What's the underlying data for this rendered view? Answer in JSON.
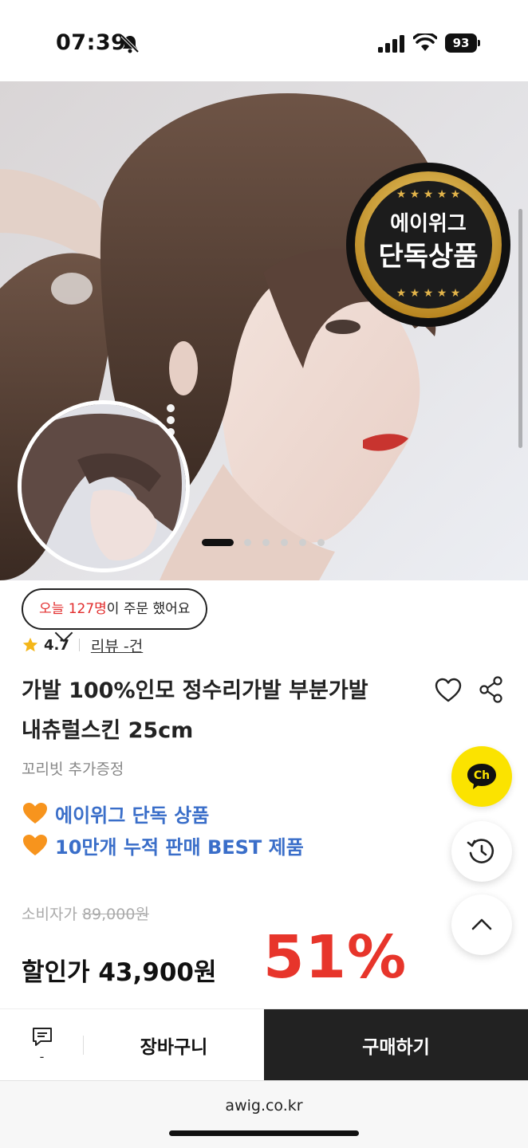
{
  "status_bar": {
    "time": "07:39",
    "battery": "93"
  },
  "hero": {
    "badge_line1": "에이위그",
    "badge_line2": "단독상품",
    "carousel_total": 6,
    "carousel_active": 1
  },
  "order_bubble": {
    "prefix": "오늘 ",
    "count": "127명",
    "suffix": "이 주문 했어요"
  },
  "rating": {
    "value": "4.7",
    "review_label": "리뷰 -건"
  },
  "product": {
    "title_line1": "가발 100%인모 정수리가발 부분가발",
    "title_line2": "내츄럴스킨 25cm",
    "subtitle": "꼬리빗 추가증정"
  },
  "promos": [
    {
      "icon": "orange-heart-icon",
      "text": "에이위그 단독 상품"
    },
    {
      "icon": "orange-heart-icon",
      "text": "10만개 누적 판매 BEST 제품"
    }
  ],
  "price": {
    "consumer_label": "소비자가 ",
    "consumer_value": "89,000원",
    "sale_label": "할인가 43,900원",
    "discount": "51%"
  },
  "floating": {
    "kakao_label": "Ch"
  },
  "bottom_bar": {
    "chat_count": "-",
    "cart_label": "장바구니",
    "buy_label": "구매하기"
  },
  "url": "awig.co.kr",
  "colors": {
    "accent_red": "#e7352b",
    "promo_blue": "#3a6ec9",
    "kakao_yellow": "#fbe300",
    "badge_gold": "#d6a93a"
  }
}
